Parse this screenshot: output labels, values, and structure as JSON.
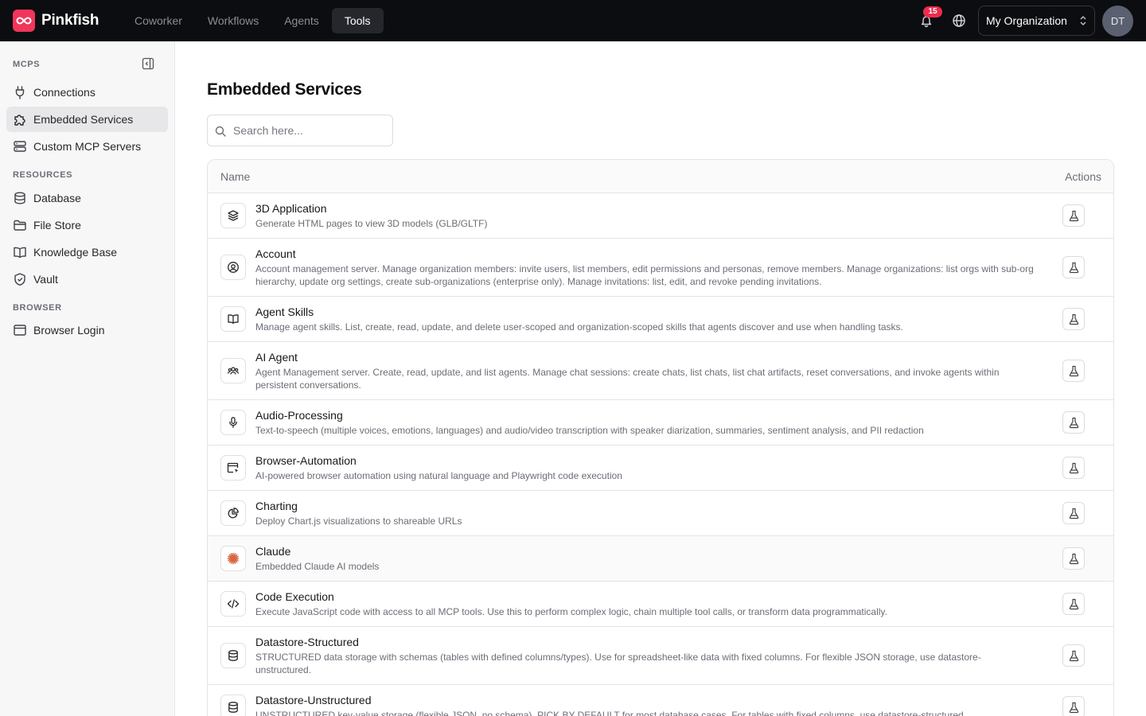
{
  "app": {
    "name": "Pinkfish"
  },
  "nav": {
    "tabs": [
      {
        "label": "Coworker"
      },
      {
        "label": "Workflows"
      },
      {
        "label": "Agents"
      },
      {
        "label": "Tools"
      }
    ],
    "active": "Tools"
  },
  "header": {
    "notifications_count": "15",
    "org_name": "My Organization",
    "avatar_initials": "DT"
  },
  "sidebar": {
    "sections": [
      {
        "label": "MCPS",
        "items": [
          {
            "label": "Connections",
            "icon": "plug-icon"
          },
          {
            "label": "Embedded Services",
            "icon": "puzzle-icon",
            "active": true
          },
          {
            "label": "Custom MCP Servers",
            "icon": "server-icon"
          }
        ]
      },
      {
        "label": "RESOURCES",
        "items": [
          {
            "label": "Database",
            "icon": "database-icon"
          },
          {
            "label": "File Store",
            "icon": "folder-icon"
          },
          {
            "label": "Knowledge Base",
            "icon": "book-icon"
          },
          {
            "label": "Vault",
            "icon": "shield-icon"
          }
        ]
      },
      {
        "label": "BROWSER",
        "items": [
          {
            "label": "Browser Login",
            "icon": "browser-icon"
          }
        ]
      }
    ]
  },
  "main": {
    "title": "Embedded Services",
    "search": {
      "placeholder": "Search here..."
    },
    "table": {
      "columns": {
        "name": "Name",
        "actions": "Actions"
      },
      "rows": [
        {
          "name": "3D Application",
          "description": "Generate HTML pages to view 3D models (GLB/GLTF)",
          "icon": "layers-icon"
        },
        {
          "name": "Account",
          "description": "Account management server. Manage organization members: invite users, list members, edit permissions and personas, remove members. Manage organizations: list orgs with sub-org hierarchy, update org settings, create sub-organizations (enterprise only). Manage invitations: list, edit, and revoke pending invitations.",
          "icon": "user-circle-icon"
        },
        {
          "name": "Agent Skills",
          "description": "Manage agent skills. List, create, read, update, and delete user-scoped and organization-scoped skills that agents discover and use when handling tasks.",
          "icon": "book-open-icon"
        },
        {
          "name": "AI Agent",
          "description": "Agent Management server. Create, read, update, and list agents. Manage chat sessions: create chats, list chats, list chat artifacts, reset conversations, and invoke agents within persistent conversations.",
          "icon": "users-icon"
        },
        {
          "name": "Audio-Processing",
          "description": "Text-to-speech (multiple voices, emotions, languages) and audio/video transcription with speaker diarization, summaries, sentiment analysis, and PII redaction",
          "icon": "microphone-icon"
        },
        {
          "name": "Browser-Automation",
          "description": "AI-powered browser automation using natural language and Playwright code execution",
          "icon": "browser-cursor-icon"
        },
        {
          "name": "Charting",
          "description": "Deploy Chart.js visualizations to shareable URLs",
          "icon": "pie-chart-icon"
        },
        {
          "name": "Claude",
          "description": "Embedded Claude AI models",
          "icon": "claude-icon"
        },
        {
          "name": "Code Execution",
          "description": "Execute JavaScript code with access to all MCP tools. Use this to perform complex logic, chain multiple tool calls, or transform data programmatically.",
          "icon": "code-icon"
        },
        {
          "name": "Datastore-Structured",
          "description": "STRUCTURED data storage with schemas (tables with defined columns/types). Use for spreadsheet-like data with fixed columns. For flexible JSON storage, use datastore-unstructured.",
          "icon": "database-icon"
        },
        {
          "name": "Datastore-Unstructured",
          "description": "UNSTRUCTURED key-value storage (flexible JSON, no schema). PICK BY DEFAULT for most database cases. For tables with fixed columns, use datastore-structured.",
          "icon": "database-icon"
        }
      ]
    }
  },
  "colors": {
    "brand": "#f0365a",
    "topbar": "#0c0d10",
    "claude": "#d9663f",
    "badge": "#ef2b4e"
  }
}
